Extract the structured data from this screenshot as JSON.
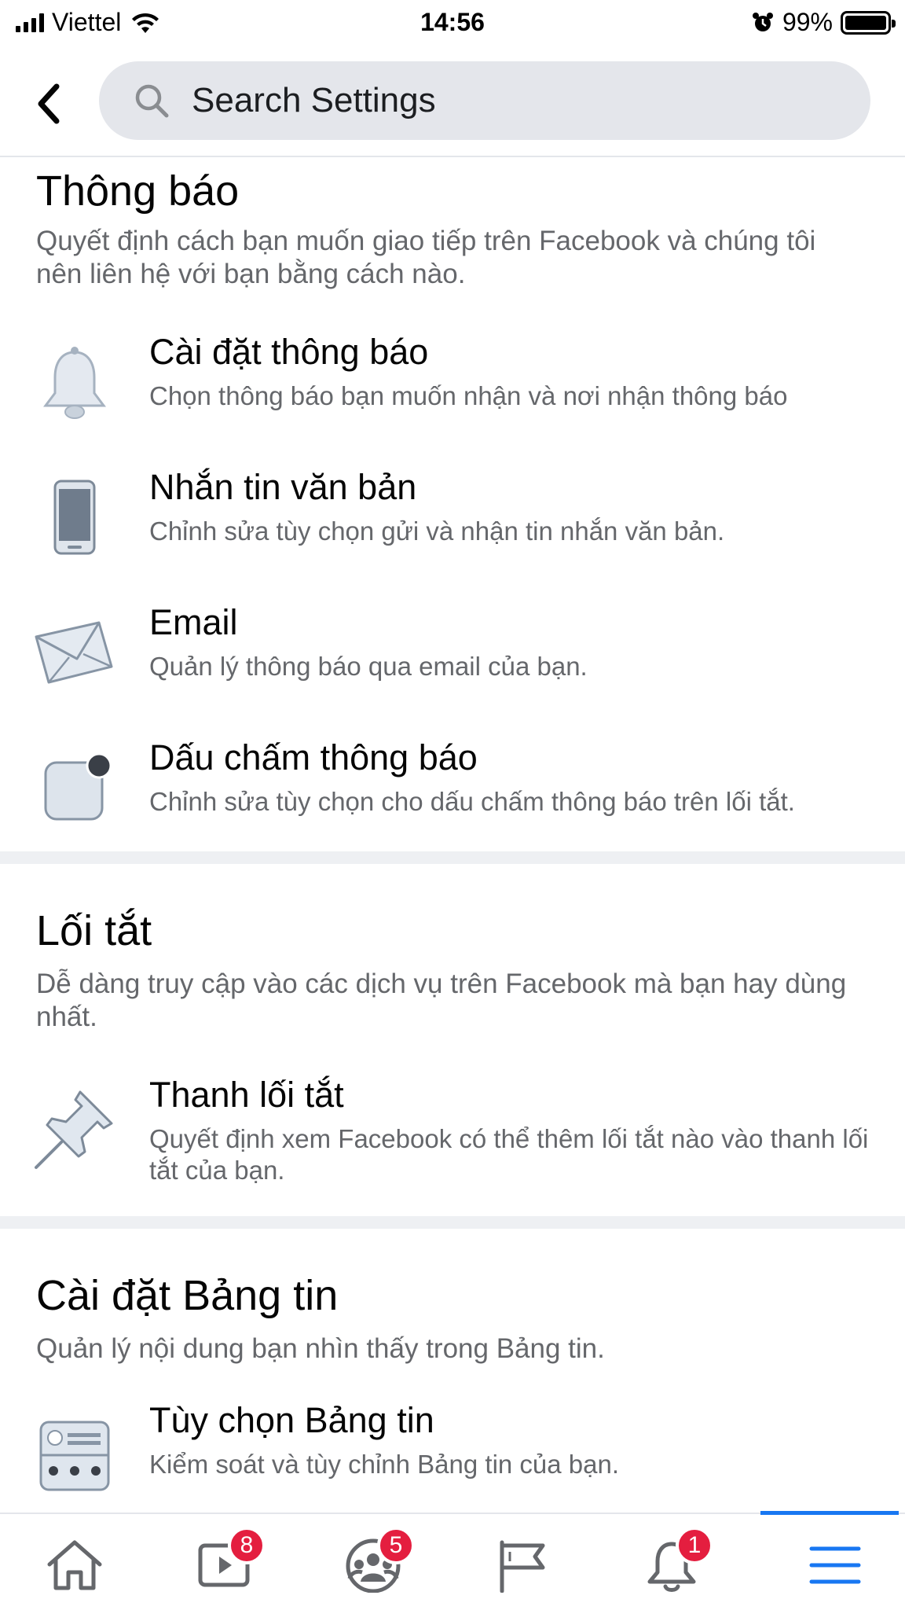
{
  "status_bar": {
    "carrier": "Viettel",
    "time": "14:56",
    "battery": "99%",
    "battery_level": 0.99
  },
  "header": {
    "search_placeholder": "Search Settings",
    "back_icon": "chevron-left-icon",
    "search_icon": "search-icon"
  },
  "sections": {
    "notifications": {
      "title": "Thông báo",
      "description": "Quyết định cách bạn muốn giao tiếp trên Facebook và chúng tôi nên liên hệ với bạn bằng cách nào.",
      "items": [
        {
          "label": "Cài đặt thông báo",
          "sub": "Chọn thông báo bạn muốn nhận và nơi nhận thông báo",
          "icon": "bell-icon"
        },
        {
          "label": "Nhắn tin văn bản",
          "sub": "Chỉnh sửa tùy chọn gửi và nhận tin nhắn văn bản.",
          "icon": "phone-icon"
        },
        {
          "label": "Email",
          "sub": "Quản lý thông báo qua email của bạn.",
          "icon": "envelope-icon"
        },
        {
          "label": "Dấu chấm thông báo",
          "sub": "Chỉnh sửa tùy chọn cho dấu chấm thông báo trên lối tắt.",
          "icon": "notification-dot-icon"
        }
      ]
    },
    "shortcuts": {
      "title": "Lối tắt",
      "description": "Dễ dàng truy cập vào các dịch vụ trên Facebook mà bạn hay dùng nhất.",
      "items": [
        {
          "label": "Thanh lối tắt",
          "sub": "Quyết định xem Facebook có thể thêm lối tắt nào vào thanh lối tắt của bạn.",
          "icon": "pushpin-icon"
        }
      ]
    },
    "news_feed": {
      "title": "Cài đặt Bảng tin",
      "description": "Quản lý nội dung bạn nhìn thấy trong Bảng tin.",
      "items": [
        {
          "label": "Tùy chọn Bảng tin",
          "sub": "Kiểm soát và tùy chỉnh Bảng tin của bạn.",
          "icon": "news-feed-icon"
        }
      ]
    }
  },
  "tabbar": {
    "tabs": [
      {
        "name": "home",
        "icon": "home-icon",
        "badge": ""
      },
      {
        "name": "watch",
        "icon": "video-icon",
        "badge": "8"
      },
      {
        "name": "groups",
        "icon": "groups-icon",
        "badge": "5"
      },
      {
        "name": "pages",
        "icon": "flag-icon",
        "badge": ""
      },
      {
        "name": "notifications",
        "icon": "bell-icon",
        "badge": "1"
      },
      {
        "name": "menu",
        "icon": "menu-icon",
        "badge": "",
        "active": true
      }
    ]
  },
  "colors": {
    "accent": "#1877f2",
    "badge": "#e41e3f",
    "secondary_text": "#65676b",
    "search_bg": "#e4e6eb"
  }
}
